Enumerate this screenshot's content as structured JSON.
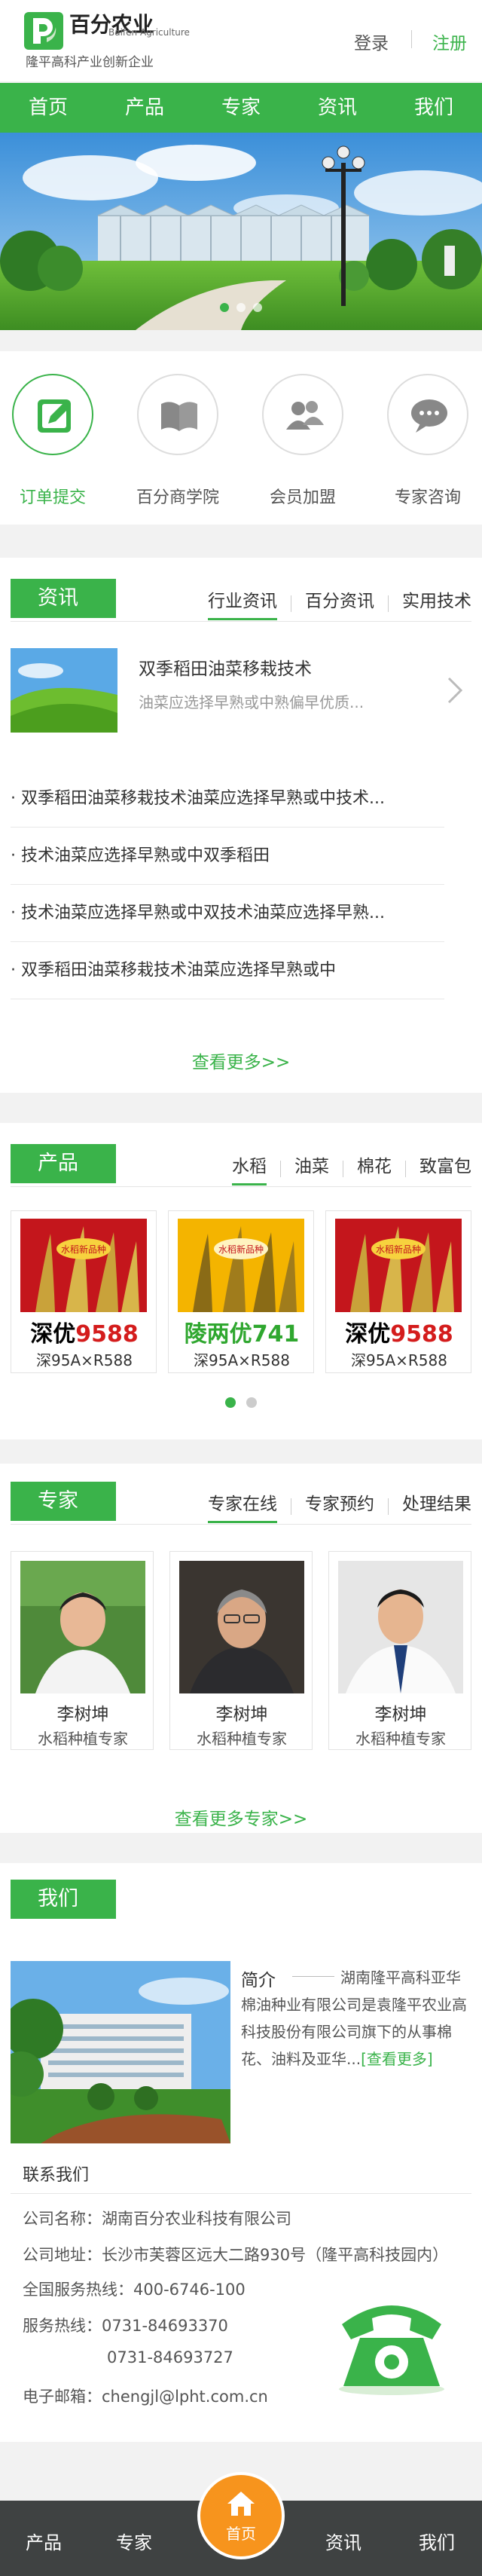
{
  "header": {
    "brand": "百分农业",
    "brand_en": "Baifen Agriculture",
    "slogan": "隆平高科产业创新企业",
    "login": "登录",
    "register": "注册"
  },
  "nav": [
    "首页",
    "产品",
    "专家",
    "资讯",
    "我们"
  ],
  "quick_links": [
    {
      "label": "订单提交",
      "icon": "edit-icon"
    },
    {
      "label": "百分商学院",
      "icon": "book-icon"
    },
    {
      "label": "会员加盟",
      "icon": "users-icon"
    },
    {
      "label": "专家咨询",
      "icon": "chat-icon"
    }
  ],
  "news": {
    "title": "资讯",
    "tabs": [
      "行业资讯",
      "百分资讯",
      "实用技术"
    ],
    "featured": {
      "title": "双季稻田油菜移栽技术",
      "summary": "油菜应选择早熟或中熟偏早优质..."
    },
    "items": [
      "双季稻田油菜移栽技术油菜应选择早熟或中技术...",
      "技术油菜应选择早熟或中双季稻田",
      "技术油菜应选择早熟或中双技术油菜应选择早熟...",
      "双季稻田油菜移栽技术油菜应选择早熟或中"
    ],
    "more": "查看更多>>"
  },
  "products": {
    "title": "产品",
    "tabs": [
      "水稻",
      "油菜",
      "棉花",
      "致富包"
    ],
    "cards": [
      {
        "prefix": "深优",
        "number": "9588",
        "spec": "深95A×R588",
        "color": "#d41c1c"
      },
      {
        "prefix": "陵两优",
        "number": "741",
        "spec": "深95A×R588",
        "color": "#2fa72f"
      },
      {
        "prefix": "深优",
        "number": "9588",
        "spec": "深95A×R588",
        "color": "#d41c1c"
      }
    ],
    "badge": "水稻新品种"
  },
  "experts": {
    "title": "专家",
    "tabs": [
      "专家在线",
      "专家预约",
      "处理结果"
    ],
    "cards": [
      {
        "name": "李树坤",
        "title": "水稻种植专家"
      },
      {
        "name": "李树坤",
        "title": "水稻种植专家"
      },
      {
        "name": "李树坤",
        "title": "水稻种植专家"
      }
    ],
    "more": "查看更多专家>>"
  },
  "about": {
    "title": "我们",
    "intro_label": "简介",
    "intro_text": "湖南隆平高科亚华棉油种业有限公司是袁隆平农业高科技股份有限公司旗下的从事棉花、油料及亚华...",
    "intro_link": "[查看更多]",
    "contact_title": "联系我们",
    "company": "公司名称：湖南百分农业科技有限公司",
    "address": "公司地址：长沙市芙蓉区远大二路930号（隆平高科技园内）",
    "hotline": "全国服务热线：400-6746-100",
    "service1": "服务热线：0731-84693370",
    "service2": "0731-84693727",
    "email": "电子邮箱：chengjl@lpht.com.cn"
  },
  "bottom_nav": {
    "items": [
      "产品",
      "专家",
      "资讯",
      "我们"
    ],
    "home": "首页"
  },
  "colors": {
    "accent": "#3ab34a",
    "bottom_bar": "#3f4242",
    "home_button": "#f7941d"
  }
}
